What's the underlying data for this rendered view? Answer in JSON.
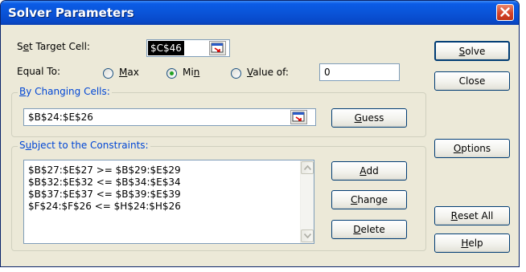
{
  "window": {
    "title": "Solver Parameters"
  },
  "target": {
    "label": "Set Target Cell:",
    "label_pre": "S",
    "label_u": "e",
    "label_post": "t Target Cell:",
    "value": "$C$46"
  },
  "equal_to": {
    "label": "Equal To:",
    "options": [
      {
        "label": "Max",
        "pre": "",
        "u": "M",
        "post": "ax",
        "selected": false
      },
      {
        "label": "Min",
        "pre": "Mi",
        "u": "n",
        "post": "",
        "selected": true
      },
      {
        "label": "Value of:",
        "pre": "",
        "u": "V",
        "post": "alue of:",
        "selected": false
      }
    ],
    "value": "0"
  },
  "changing_cells": {
    "legend": "By Changing Cells:",
    "pre": "",
    "u": "B",
    "post": "y Changing Cells:",
    "value": "$B$24:$E$26"
  },
  "constraints": {
    "legend": "Subject to the Constraints:",
    "pre": "S",
    "u": "u",
    "post": "bject to the Constraints:",
    "items": [
      "$B$27:$E$27 >= $B$29:$E$29",
      "$B$32:$E$32 <= $B$34:$E$34",
      "$B$37:$E$37 <= $B$39:$E$39",
      "$F$24:$F$26 <= $H$24:$H$26"
    ]
  },
  "buttons": {
    "guess": {
      "label": "Guess",
      "pre": "",
      "u": "G",
      "post": "uess"
    },
    "add": {
      "label": "Add",
      "pre": "",
      "u": "A",
      "post": "dd"
    },
    "change": {
      "label": "Change",
      "pre": "",
      "u": "C",
      "post": "hange"
    },
    "delete": {
      "label": "Delete",
      "pre": "",
      "u": "D",
      "post": "elete"
    },
    "solve": {
      "label": "Solve",
      "pre": "",
      "u": "S",
      "post": "olve"
    },
    "close": {
      "label": "Close"
    },
    "options": {
      "label": "Options",
      "pre": "",
      "u": "O",
      "post": "ptions"
    },
    "reset_all": {
      "label": "Reset All",
      "pre": "",
      "u": "R",
      "post": "eset All"
    },
    "help": {
      "label": "Help",
      "pre": "",
      "u": "H",
      "post": "elp"
    }
  },
  "colors": {
    "title_bar": "#0a54d8",
    "dialog_bg": "#ece9d8",
    "group_legend": "#0046d5",
    "close_button": "#d5442a",
    "radio_selected": "#21a121"
  },
  "icons": [
    "close-icon",
    "collapse-dialog-icon",
    "scroll-up-arrow-icon",
    "scroll-down-arrow-icon"
  ]
}
